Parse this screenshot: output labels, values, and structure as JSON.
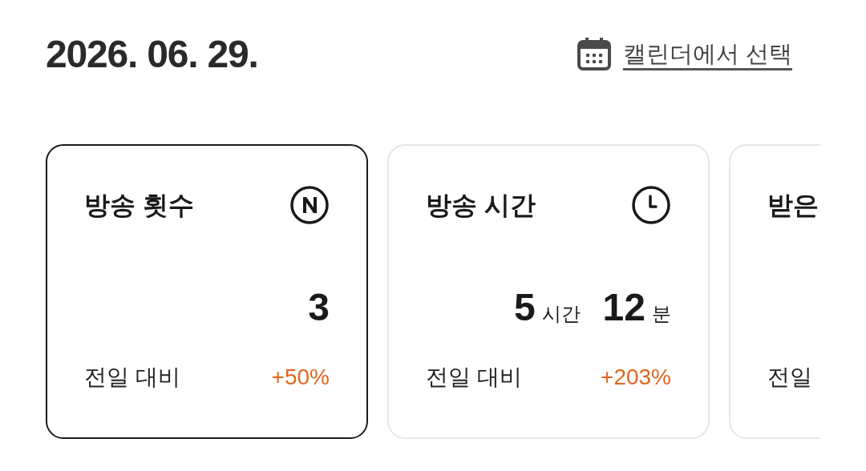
{
  "date": "2026. 06. 29.",
  "calendar_link": "캘린더에서 선택",
  "cards": [
    {
      "kind": "count",
      "title": "방송 횟수",
      "selected": true,
      "value_parts": [
        {
          "number": "3"
        }
      ],
      "comparison_label": "전일 대비",
      "change": "+50%"
    },
    {
      "kind": "duration",
      "title": "방송 시간",
      "selected": false,
      "value_parts": [
        {
          "number": "5",
          "unit": "시간"
        },
        {
          "number": "12",
          "unit": "분"
        }
      ],
      "comparison_label": "전일 대비",
      "change": "+203%"
    },
    {
      "kind": "clipped",
      "title": "받은",
      "selected": false,
      "comparison_label": "전일"
    }
  ]
}
